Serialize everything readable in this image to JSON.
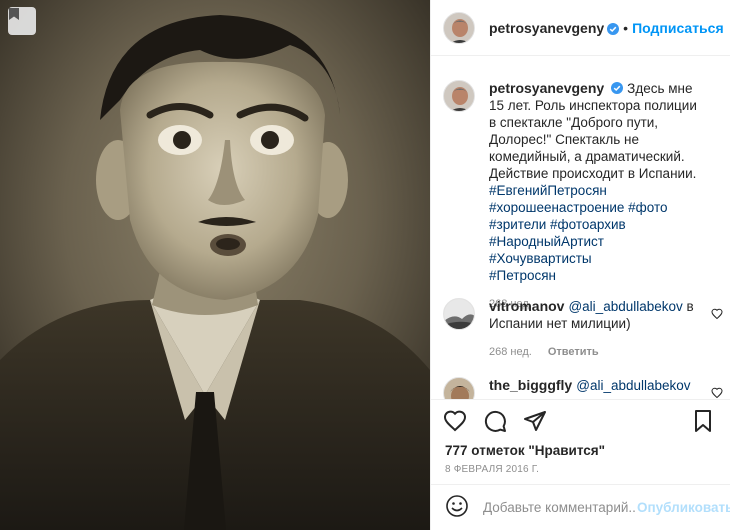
{
  "post": {
    "author": "petrosyanevgeny",
    "verified": true,
    "follow_label": "Подписаться",
    "dot": "•",
    "caption_text": "Здесь мне 15 лет. Роль инспектора полиции в спектакле \"Доброго пути, Долорес!\" Спектакль не комедийный, а драматический. Действие происходит в Испании.",
    "hashtags": [
      "#ЕвгенийПетросян",
      "#хорошеенастроение",
      "#фото",
      "#зрители",
      "#фотоархив",
      "#НародныйАртист",
      "#Хочуввартисты",
      "#Петросян"
    ],
    "caption_age": "268 нед.",
    "likes_count": "777",
    "likes_text": "отметок \"Нравится\"",
    "date": "8 ФЕВРАЛЯ 2016 Г.",
    "comment_placeholder": "Добавьте комментарий...",
    "publish_label": "Опубликовать"
  },
  "comments": [
    {
      "user": "vitromanov",
      "mention": "@ali_abdullabekov",
      "text": "в Испании нет милиции)",
      "age": "268 нед.",
      "reply_label": "Ответить"
    },
    {
      "user": "the_bigggfly",
      "mention": "@ali_abdullabekov",
      "text": "",
      "age": "",
      "reply_label": ""
    }
  ],
  "colors": {
    "accent": "#0095f6",
    "hashtag": "#00376b",
    "muted": "#8e8e8e",
    "publish_disabled": "#b2dffc",
    "verified_badge": "#3897f0"
  },
  "icons": [
    "bookmark-icon",
    "verified-icon",
    "heart-icon",
    "comment-icon",
    "share-icon",
    "save-icon",
    "emoji-icon"
  ]
}
